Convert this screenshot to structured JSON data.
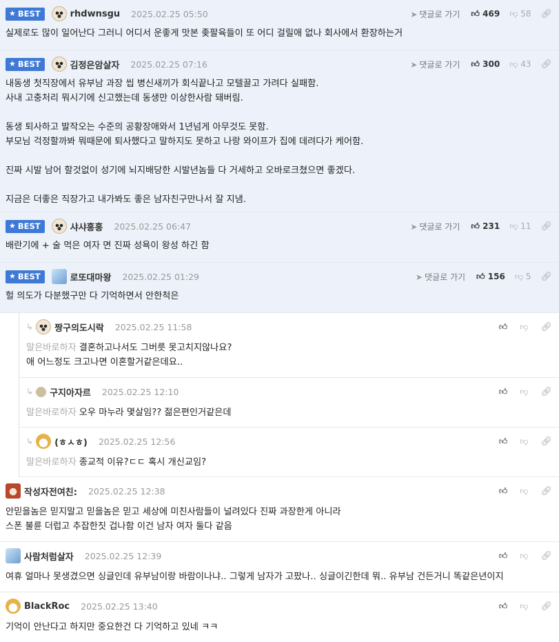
{
  "ui": {
    "goto_label": "댓글로 가기",
    "best_label": "BEST",
    "reply_prefix": "말은바로하자"
  },
  "best_comments": [
    {
      "nick": "rhdwnsgu",
      "date": "2025.02.25 05:50",
      "up": "469",
      "down": "58",
      "lines": [
        "실제로도 많이 일어난다 그러니 어디서 운좋게 맛본 좆팔육들이 또 어디 걸릴애 없나 회사에서 환장하는거"
      ]
    },
    {
      "nick": "김정은암살자",
      "date": "2025.02.25 07:16",
      "up": "300",
      "down": "43",
      "lines": [
        "내동생 첫직장에서 유부남 과장 씹 병신새끼가 회식끝나고 모텔끌고 가려다 실패함.",
        "사내 고충처리 뭐시기에 신고했는데 동생만 이상한사람 돼버림.",
        "",
        "동생 퇴사하고 발작오는 수준의 공황장애와서 1년넘게 아무것도 못함.",
        "부모님 걱정할까봐 뭐때문에 퇴사했다고 말하지도 못하고 나랑 와이프가 집에 데려다가 케어함.",
        "",
        "진짜 시발 남어 할것없이 성기에 뇌지배당한 시발년놈들 다 거세하고 오바로크쳤으면 좋겠다.",
        "",
        "지금은 더좋은 직장가고 내가봐도 좋은 남자친구만나서 잘 지냄."
      ]
    },
    {
      "nick": "샤샤홍홍",
      "date": "2025.02.25 06:47",
      "up": "231",
      "down": "11",
      "lines": [
        "배란기에 + 술 먹은 여자 면 진짜 성욕이 왕성 하긴 함"
      ]
    },
    {
      "nick": "로또대마왕",
      "date": "2025.02.25 01:29",
      "up": "156",
      "down": "5",
      "lines": [
        "헐 의도가 다분했구만 다 기억하면서 안한척은"
      ]
    }
  ],
  "replies": [
    {
      "nick": "짱구의도시락",
      "date": "2025.02.25 11:58",
      "lines": [
        "결혼하고나서도 그버릇 못고치지않나요?",
        "애 어느정도 크고나면 이혼할거같은데요.."
      ]
    },
    {
      "nick": "구지아자르",
      "date": "2025.02.25 12:10",
      "lines": [
        "오우 마누라 몇살임?? 젊은편인거같은데"
      ]
    },
    {
      "nick": "(ㅎㅅㅎ)",
      "date": "2025.02.25 12:56",
      "lines": [
        "종교적 이유?ㄷㄷ 혹시 개신교임?"
      ]
    }
  ],
  "comments": [
    {
      "nick": "작성자전여친:",
      "date": "2025.02.25 12:38",
      "lines": [
        "안믿을놈은 믿지말고 믿을놈은 믿고 세상에 미친사람들이 널려있다 진짜 과장한게 아니라",
        "스폰 불륜 더럽고 추잡한짓 겁나함 이건 남자 여자 둘다 같음"
      ]
    },
    {
      "nick": "사람처럼살자",
      "date": "2025.02.25 12:39",
      "lines": [
        "여휴 얼마나 못생겼으면 싱글인데 유부남이랑 바람이나냐.. 그렇게 남자가 고팠나.. 싱글이긴한데 뭐.. 유부남 건든거니 똑같은년이지"
      ]
    },
    {
      "nick": "BlackRoc",
      "date": "2025.02.25 13:40",
      "lines": [
        "기억이 안난다고 하지만 중요한건 다 기억하고 있네 ㅋㅋ"
      ]
    }
  ]
}
